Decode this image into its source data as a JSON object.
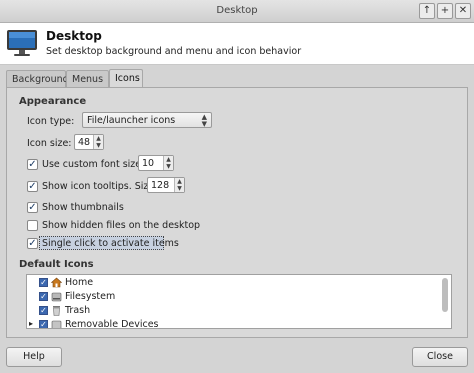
{
  "window": {
    "title": "Desktop",
    "btn_up": "↑",
    "btn_plus": "+",
    "btn_close": "✕"
  },
  "header": {
    "title": "Desktop",
    "subtitle": "Set desktop background and menu and icon behavior",
    "icon": "monitor-icon"
  },
  "tabs": [
    {
      "label": "Background",
      "active": false
    },
    {
      "label": "Menus",
      "active": false
    },
    {
      "label": "Icons",
      "active": true
    }
  ],
  "appearance": {
    "section_title": "Appearance",
    "icon_type_label": "Icon type:",
    "icon_type_value": "File/launcher icons",
    "icon_size_label": "Icon size:",
    "icon_size_value": "48",
    "custom_font": {
      "label": "Use custom font size:",
      "checked": true,
      "value": "10"
    },
    "tooltips": {
      "label": "Show icon tooltips. Size:",
      "checked": true,
      "value": "128"
    },
    "thumbnails": {
      "label": "Show thumbnails",
      "checked": true
    },
    "hidden_files": {
      "label": "Show hidden files on the desktop",
      "checked": false
    },
    "single_click": {
      "label": "Single click to activate items",
      "checked": true
    }
  },
  "default_icons": {
    "section_title": "Default Icons",
    "items": [
      {
        "label": "Home",
        "checked": true,
        "icon": "home-icon"
      },
      {
        "label": "Filesystem",
        "checked": true,
        "icon": "drive-icon"
      },
      {
        "label": "Trash",
        "checked": true,
        "icon": "trash-icon"
      },
      {
        "label": "Removable Devices",
        "checked": true,
        "icon": "removable-drive-icon",
        "expander": "▸"
      }
    ]
  },
  "footer": {
    "help_label": "Help",
    "close_label": "Close"
  },
  "colors": {
    "window_bg": "#d4d4d4",
    "header_bg": "#ffffff",
    "check_accent": "#3b68b0",
    "selection": "#c7d1e0"
  }
}
